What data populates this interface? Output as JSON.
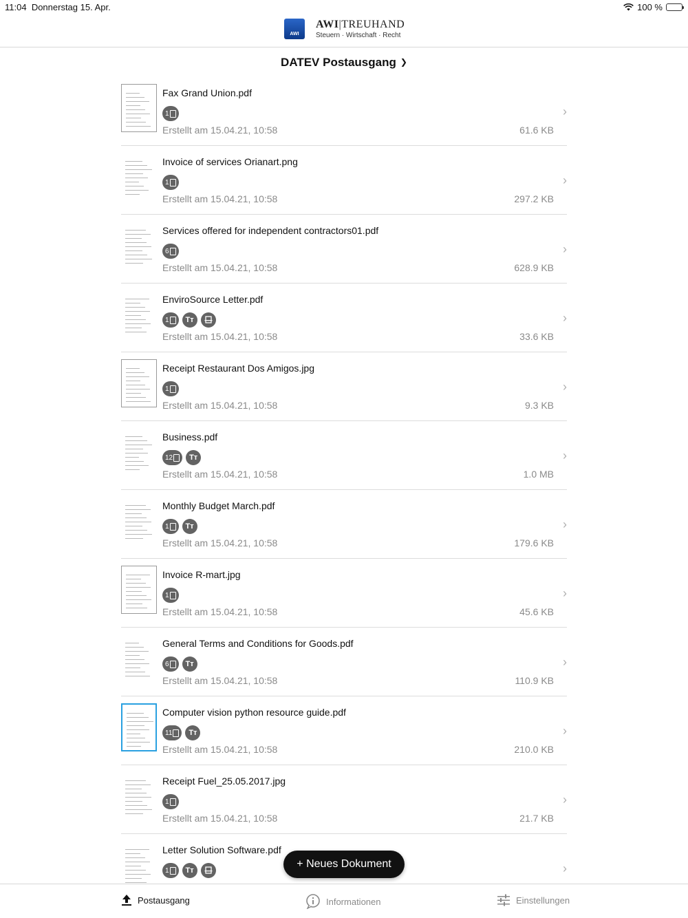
{
  "status": {
    "time": "11:04",
    "date": "Donnerstag 15. Apr.",
    "battery": "100 %"
  },
  "header": {
    "brand_bold": "AWI",
    "brand_rest": "|TREUHAND",
    "tagline": "Steuern · Wirtschaft · Recht",
    "logo_mark": "AWI"
  },
  "section": {
    "title": "DATEV Postausgang"
  },
  "documents": [
    {
      "name": "Fax Grand Union.pdf",
      "pages": "1",
      "text": false,
      "ocr": false,
      "created": "Erstellt am 15.04.21, 10:58",
      "size": "61.6 KB"
    },
    {
      "name": "Invoice of services Orianart.png",
      "pages": "1",
      "text": false,
      "ocr": false,
      "created": "Erstellt am 15.04.21, 10:58",
      "size": "297.2 KB"
    },
    {
      "name": "Services offered for independent contractors01.pdf",
      "pages": "6",
      "text": false,
      "ocr": false,
      "created": "Erstellt am 15.04.21, 10:58",
      "size": "628.9 KB"
    },
    {
      "name": "EnviroSource Letter.pdf",
      "pages": "1",
      "text": true,
      "ocr": true,
      "created": "Erstellt am 15.04.21, 10:58",
      "size": "33.6 KB"
    },
    {
      "name": "Receipt Restaurant Dos Amigos.jpg",
      "pages": "1",
      "text": false,
      "ocr": false,
      "created": "Erstellt am 15.04.21, 10:58",
      "size": "9.3 KB"
    },
    {
      "name": "Business.pdf",
      "pages": "12",
      "text": true,
      "ocr": false,
      "created": "Erstellt am 15.04.21, 10:58",
      "size": "1.0 MB"
    },
    {
      "name": "Monthly Budget March.pdf",
      "pages": "1",
      "text": true,
      "ocr": false,
      "created": "Erstellt am 15.04.21, 10:58",
      "size": "179.6 KB"
    },
    {
      "name": "Invoice R-mart.jpg",
      "pages": "1",
      "text": false,
      "ocr": false,
      "created": "Erstellt am 15.04.21, 10:58",
      "size": "45.6 KB"
    },
    {
      "name": "General Terms and Conditions for Goods.pdf",
      "pages": "6",
      "text": true,
      "ocr": false,
      "created": "Erstellt am 15.04.21, 10:58",
      "size": "110.9 KB"
    },
    {
      "name": "Computer vision python resource guide.pdf",
      "pages": "11",
      "text": true,
      "ocr": false,
      "created": "Erstellt am 15.04.21, 10:58",
      "size": "210.0 KB"
    },
    {
      "name": "Receipt Fuel_25.05.2017.jpg",
      "pages": "1",
      "text": false,
      "ocr": false,
      "created": "Erstellt am 15.04.21, 10:58",
      "size": "21.7 KB"
    },
    {
      "name": "Letter Solution Software.pdf",
      "pages": "1",
      "text": true,
      "ocr": true,
      "created": "",
      "size": ""
    }
  ],
  "text_badge_label": "Tт",
  "fab": {
    "label": "+ Neues Dokument"
  },
  "tabs": [
    {
      "label": "Postausgang",
      "icon": "upload-icon",
      "active": true
    },
    {
      "label": "Informationen",
      "icon": "info-icon",
      "active": false
    },
    {
      "label": "Einstellungen",
      "icon": "sliders-icon",
      "active": false
    }
  ]
}
